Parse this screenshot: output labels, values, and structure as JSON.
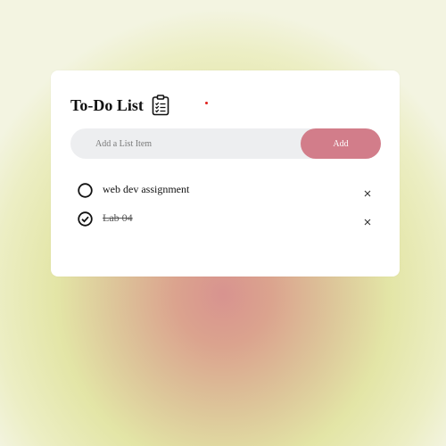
{
  "app": {
    "title": "To-Do List",
    "title_icon": "clipboard-list-icon"
  },
  "input": {
    "placeholder": "Add a List Item",
    "value": ""
  },
  "add_button": {
    "label": "Add"
  },
  "tasks": [
    {
      "text": "web dev assignment",
      "completed": false,
      "status_icon": "unchecked-circle-icon",
      "delete_icon": "close-icon"
    },
    {
      "text": "Lab 04",
      "completed": true,
      "status_icon": "checked-circle-icon",
      "delete_icon": "close-icon"
    }
  ],
  "colors": {
    "accent": "#d27d8a",
    "input_background": "#edeef0",
    "card_background": "#ffffff",
    "marker_dot": "#e0201c"
  }
}
